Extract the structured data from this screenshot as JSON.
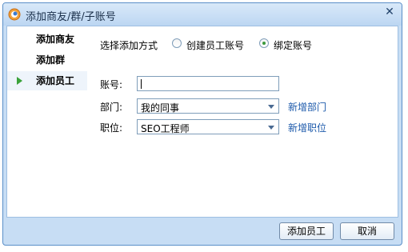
{
  "window": {
    "title": "添加商友/群/子账号",
    "close_symbol": "✕"
  },
  "sidebar": {
    "items": [
      {
        "label": "添加商友",
        "active": false
      },
      {
        "label": "添加群",
        "active": false
      },
      {
        "label": "添加员工",
        "active": true
      }
    ]
  },
  "form": {
    "method_label": "选择添加方式",
    "options": [
      {
        "label": "创建员工账号",
        "selected": false
      },
      {
        "label": "绑定账号",
        "selected": true
      }
    ],
    "account": {
      "label": "账号:",
      "value": ""
    },
    "department": {
      "label": "部门:",
      "value": "我的同事",
      "link": "新增部门"
    },
    "position": {
      "label": "职位:",
      "value": "SEO工程师",
      "link": "新增职位"
    }
  },
  "footer": {
    "primary_label": "添加员工",
    "cancel_label": "取消"
  },
  "icons": {
    "title_icon": "app-logo-icon",
    "active_marker": "arrow-right-icon"
  },
  "colors": {
    "frame": "#c7ddf4",
    "link": "#1d5aab",
    "active_marker": "#3aa23a"
  }
}
